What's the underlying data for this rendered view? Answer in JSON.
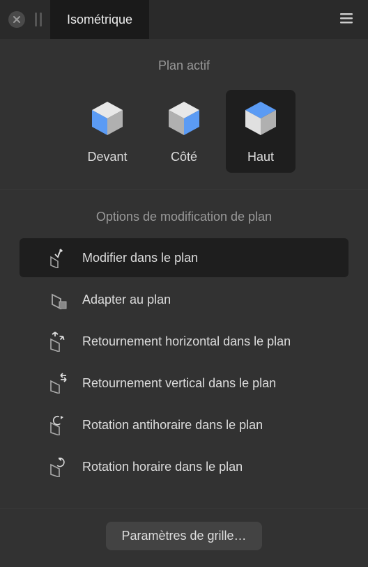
{
  "titlebar": {
    "tab_label": "Isométrique"
  },
  "active_plane": {
    "title": "Plan actif",
    "items": [
      {
        "label": "Devant",
        "face": "front",
        "active": false
      },
      {
        "label": "Côté",
        "face": "side",
        "active": false
      },
      {
        "label": "Haut",
        "face": "top",
        "active": true
      }
    ]
  },
  "modification": {
    "title": "Options de modification de plan",
    "options": [
      {
        "label": "Modifier dans le plan",
        "active": true
      },
      {
        "label": "Adapter au plan",
        "active": false
      },
      {
        "label": "Retournement horizontal dans le plan",
        "active": false
      },
      {
        "label": "Retournement vertical dans le plan",
        "active": false
      },
      {
        "label": "Rotation antihoraire dans le plan",
        "active": false
      },
      {
        "label": "Rotation horaire dans le plan",
        "active": false
      }
    ]
  },
  "footer": {
    "grid_settings_label": "Paramètres de grille…"
  },
  "colors": {
    "highlight": "#5B9BF4",
    "panel_bg": "#323232",
    "active_bg": "#1e1e1e"
  }
}
